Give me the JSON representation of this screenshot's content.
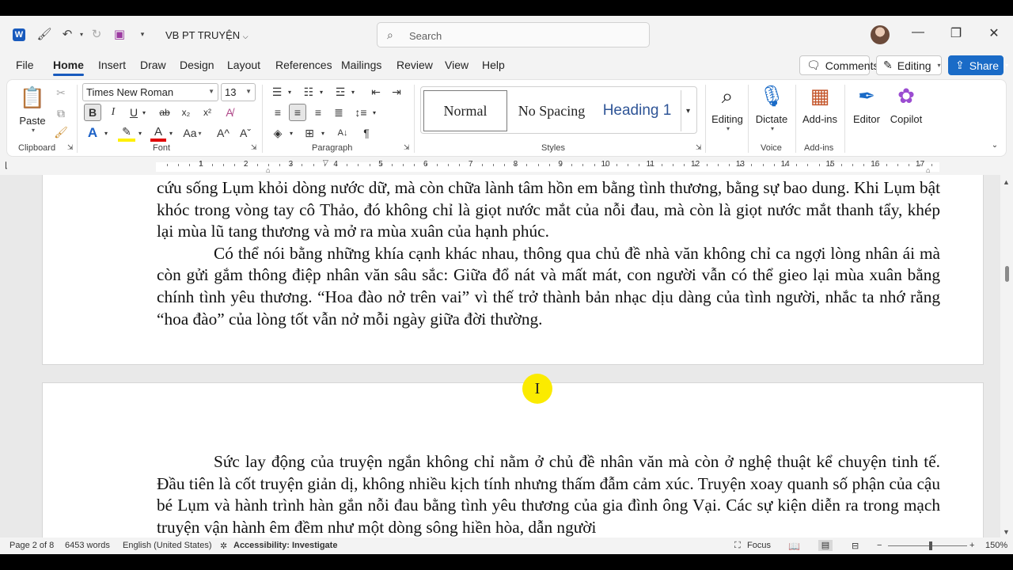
{
  "titlebar": {
    "doc_title": "VB PT TRUYỆN",
    "search_placeholder": "Search",
    "min": "—",
    "restore": "❐",
    "close": "✕"
  },
  "tabs": [
    "File",
    "Home",
    "Insert",
    "Draw",
    "Design",
    "Layout",
    "References",
    "Mailings",
    "Review",
    "View",
    "Help"
  ],
  "actions": {
    "comments": "Comments",
    "editing": "Editing",
    "share": "Share"
  },
  "ribbon": {
    "paste": "Paste",
    "clipboard": "Clipboard",
    "font_name": "Times New Roman",
    "font_size": "13",
    "font": "Font",
    "paragraph": "Paragraph",
    "styles": [
      "Normal",
      "No Spacing",
      "Heading 1"
    ],
    "styles_label": "Styles",
    "editing": "Editing",
    "dictate": "Dictate",
    "voice": "Voice",
    "addins": "Add-ins",
    "addins_group": "Add-ins",
    "editor": "Editor",
    "copilot": "Copilot",
    "bold": "B",
    "italic": "I",
    "underline": "U",
    "strike": "ab",
    "sub": "x₂",
    "sup": "x²",
    "case": "Aa",
    "grow": "A^",
    "shrink": "Aˇ"
  },
  "ruler": [
    "1",
    "1",
    "2",
    "3",
    "4",
    "5",
    "6",
    "7",
    "8",
    "9",
    "10",
    "11",
    "12",
    "13",
    "14",
    "15",
    "16",
    "17"
  ],
  "page1": {
    "lines": [
      "cứu sống Lụm khỏi dòng nước dữ, mà còn chữa lành tâm hồn em bằng tình thương, bằng sự bao dung. Khi Lụm bật khóc trong vòng tay cô Thảo, đó không chỉ là giọt nước mắt của nỗi đau, mà còn là giọt nước mắt thanh tẩy, khép lại mùa lũ tang thương và mở ra mùa xuân của hạnh phúc.",
      "Có thể nói bằng những khía cạnh khác nhau, thông qua chủ đề nhà văn không chỉ ca ngợi lòng nhân ái  mà còn gửi gắm thông điệp nhân văn sâu sắc: Giữa đổ nát và mất mát, con người vẫn có thể gieo lại mùa xuân bằng chính tình yêu thương. “Hoa đào nở trên vai” vì thế trở thành bản nhạc dịu dàng của tình người, nhắc ta nhớ rằng “hoa đào” của lòng tốt vẫn nở mỗi ngày giữa đời thường."
    ]
  },
  "page2": {
    "text": "Sức lay động của truyện ngắn không chỉ nằm ở chủ đề nhân văn mà còn ở nghệ thuật kể chuyện tinh tế. Đầu tiên là cốt truyện giản dị, không nhiều kịch tính nhưng thấm đẫm cảm xúc. Truyện xoay quanh số phận của cậu bé Lụm và hành trình hàn gắn nỗi đau bằng tình yêu thương của gia đình ông Vại. Các sự kiện diễn ra trong mạch truyện vận hành êm đềm như một dòng sông hiền hòa, dẫn người"
  },
  "cursor_glyph": "I",
  "status": {
    "page": "Page 2 of 8",
    "words": "6453 words",
    "language": "English (United States)",
    "accessibility": "Accessibility: Investigate",
    "focus": "Focus",
    "zoom": "150%"
  }
}
